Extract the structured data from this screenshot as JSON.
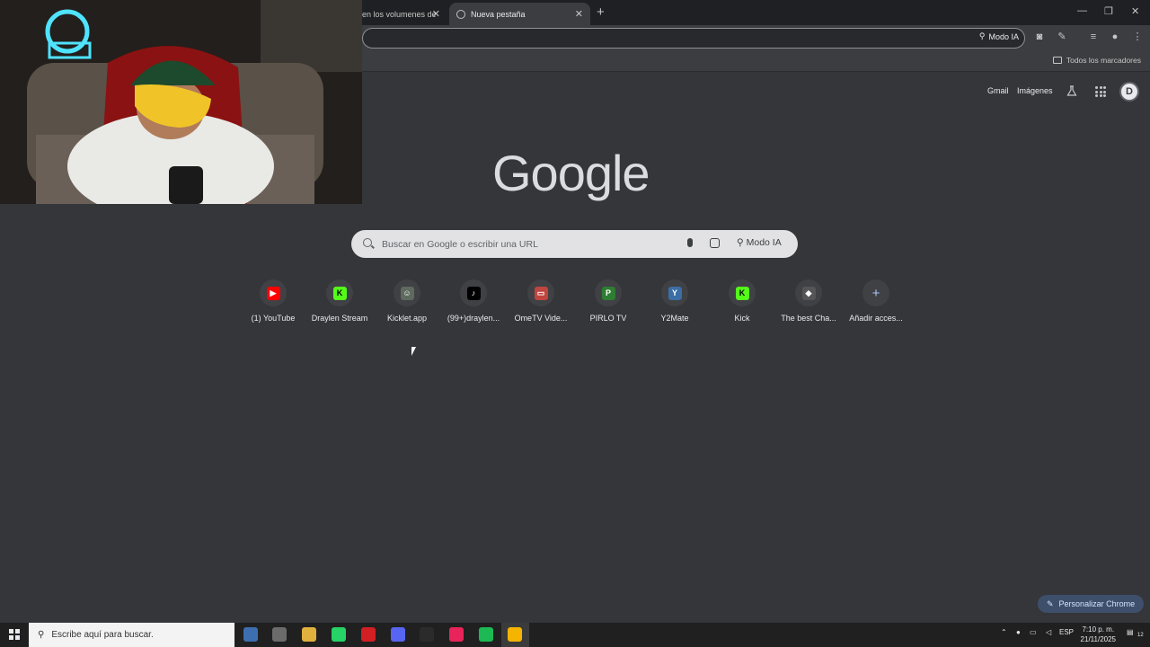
{
  "browser": {
    "tabs": [
      {
        "title": "en los volumenes de",
        "active": false
      },
      {
        "title": "Nueva pestaña",
        "active": true
      }
    ],
    "omnibox_modo": "Modo IA",
    "bookmarks_all": "Todos los marcadores"
  },
  "ntp": {
    "toplinks": {
      "gmail": "Gmail",
      "images": "Imágenes"
    },
    "avatar_letter": "D",
    "logo": {
      "text": "Google",
      "colors": [
        "#dadce0"
      ]
    },
    "search": {
      "placeholder": "Buscar en Google o escribir una URL",
      "modo_label": "Modo IA"
    },
    "shortcuts": [
      {
        "label": "(1) YouTube",
        "icon": "youtube-icon",
        "color": "#ff0000",
        "glyph": "▶"
      },
      {
        "label": "Draylen Stream",
        "icon": "kick-icon",
        "color": "#53fc18",
        "glyph": "K"
      },
      {
        "label": "Kicklet.app",
        "icon": "kicklet-icon",
        "color": "#5f6a5f",
        "glyph": "☺"
      },
      {
        "label": "(99+)draylen...",
        "icon": "tiktok-icon",
        "color": "#000000",
        "glyph": "♪"
      },
      {
        "label": "OmeTV Vide...",
        "icon": "ometv-icon",
        "color": "#c0453f",
        "glyph": "▭"
      },
      {
        "label": "PIRLO TV",
        "icon": "pirlo-icon",
        "color": "#2e7d32",
        "glyph": "P"
      },
      {
        "label": "Y2Mate",
        "icon": "y2mate-icon",
        "color": "#3b6ea5",
        "glyph": "Y"
      },
      {
        "label": "Kick",
        "icon": "kick-icon",
        "color": "#53fc18",
        "glyph": "K"
      },
      {
        "label": "The best Cha...",
        "icon": "chat-icon",
        "color": "#555558",
        "glyph": "◆"
      },
      {
        "label": "Añadir acces...",
        "icon": "plus-icon",
        "color": "#404145",
        "glyph": "+"
      }
    ],
    "personalize": "Personalizar Chrome"
  },
  "taskbar": {
    "search_placeholder": "Escribe aquí para buscar.",
    "lang": "ESP",
    "time": "7:10 p. m.",
    "date": "21/11/2025",
    "notif_count": "12",
    "apps": [
      {
        "icon": "files-app-icon",
        "color": "#3d6fb0"
      },
      {
        "icon": "media-app-icon",
        "color": "#6b6b6b"
      },
      {
        "icon": "folder-icon",
        "color": "#e0b13c"
      },
      {
        "icon": "whatsapp-icon",
        "color": "#25d366"
      },
      {
        "icon": "opera-icon",
        "color": "#d11f24"
      },
      {
        "icon": "discord-icon",
        "color": "#5865f2"
      },
      {
        "icon": "obs-icon",
        "color": "#2b2b2b"
      },
      {
        "icon": "tiktok-app-icon",
        "color": "#e9245b"
      },
      {
        "icon": "spotify-icon",
        "color": "#1db954"
      },
      {
        "icon": "chrome-icon",
        "color": "#f4b400"
      }
    ]
  }
}
